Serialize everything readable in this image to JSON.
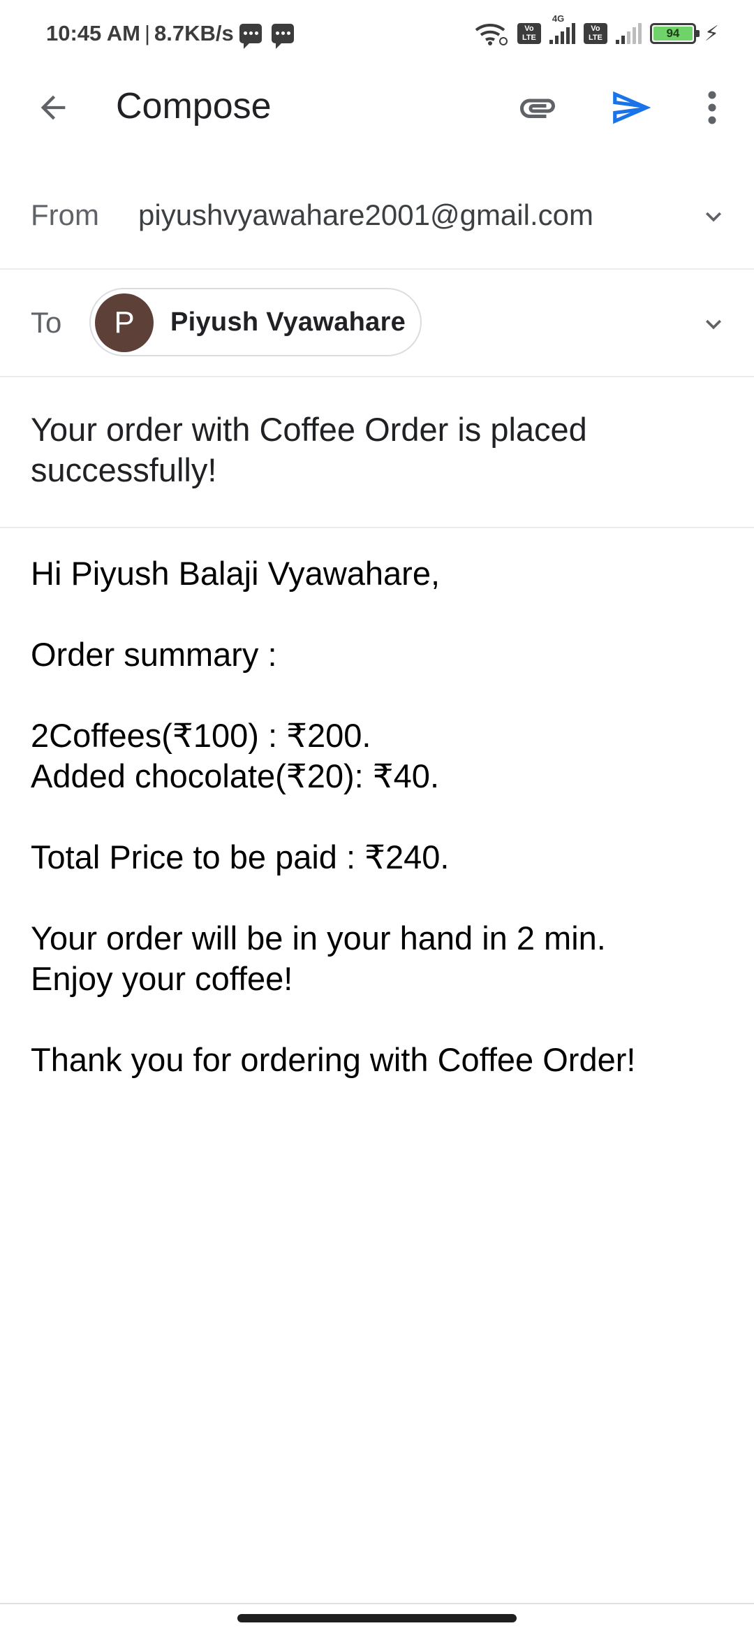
{
  "status_bar": {
    "time": "10:45 AM",
    "separator": "|",
    "speed": "8.7KB/s",
    "network_label": "4G",
    "volte_label": "Vo\nLTE",
    "battery_level": "94"
  },
  "app_bar": {
    "title": "Compose"
  },
  "from": {
    "label": "From",
    "value": "piyushvyawahare2001@gmail.com"
  },
  "to": {
    "label": "To",
    "recipient_initial": "P",
    "recipient_name": "Piyush Vyawahare"
  },
  "subject": "Your order with Coffee Order is placed successfully!",
  "body": {
    "greeting": "Hi Piyush Balaji Vyawahare,",
    "summary_heading": "Order summary :",
    "line_coffees": "2Coffees(₹100) : ₹200.",
    "line_chocolate": "Added chocolate(₹20): ₹40.",
    "total": "Total Price to be paid : ₹240.",
    "eta": "Your order will be in your hand in 2 min.",
    "enjoy": "Enjoy your coffee!",
    "thanks": "Thank you for ordering with Coffee Order!"
  },
  "colors": {
    "accent_send": "#1a73e8",
    "avatar_bg": "#5d4037",
    "battery_fill": "#6fd36a"
  }
}
